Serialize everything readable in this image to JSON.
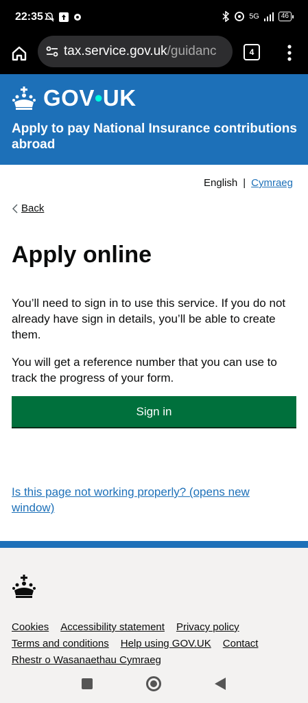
{
  "status_bar": {
    "time": "22:35",
    "network": "5G",
    "battery": "46"
  },
  "browser": {
    "url_host": "tax.service.gov.uk",
    "url_path": "/guidanc",
    "tab_count": "4"
  },
  "header": {
    "logo_text_left": "GOV",
    "logo_dot": "•",
    "logo_text_right": "UK",
    "service_name": "Apply to pay National Insurance contributions abroad"
  },
  "language": {
    "current": "English",
    "separator": "|",
    "alternate": "Cymraeg"
  },
  "back_link": "Back",
  "main": {
    "title": "Apply online",
    "paragraph1": "You’ll need to sign in to use this service. If you do not already have sign in details, you’ll be able to create them.",
    "paragraph2": "You will get a reference number that you can use to track the progress of your form.",
    "sign_in_label": "Sign in",
    "report_link": "Is this page not working properly? (opens new window)"
  },
  "footer": {
    "links": [
      "Cookies",
      "Accessibility statement",
      "Privacy policy",
      "Terms and conditions",
      "Help using GOV.UK",
      "Contact",
      "Rhestr o Wasanaethau Cymraeg"
    ]
  },
  "colors": {
    "brand_blue": "#1d70b8",
    "button_green": "#00703c",
    "text": "#0b0c0c",
    "footer_bg": "#f3f2f1"
  },
  "icons": [
    "home-icon",
    "site-settings-icon",
    "tabs-icon",
    "more-menu-icon",
    "crown-icon",
    "back-chevron-icon"
  ]
}
